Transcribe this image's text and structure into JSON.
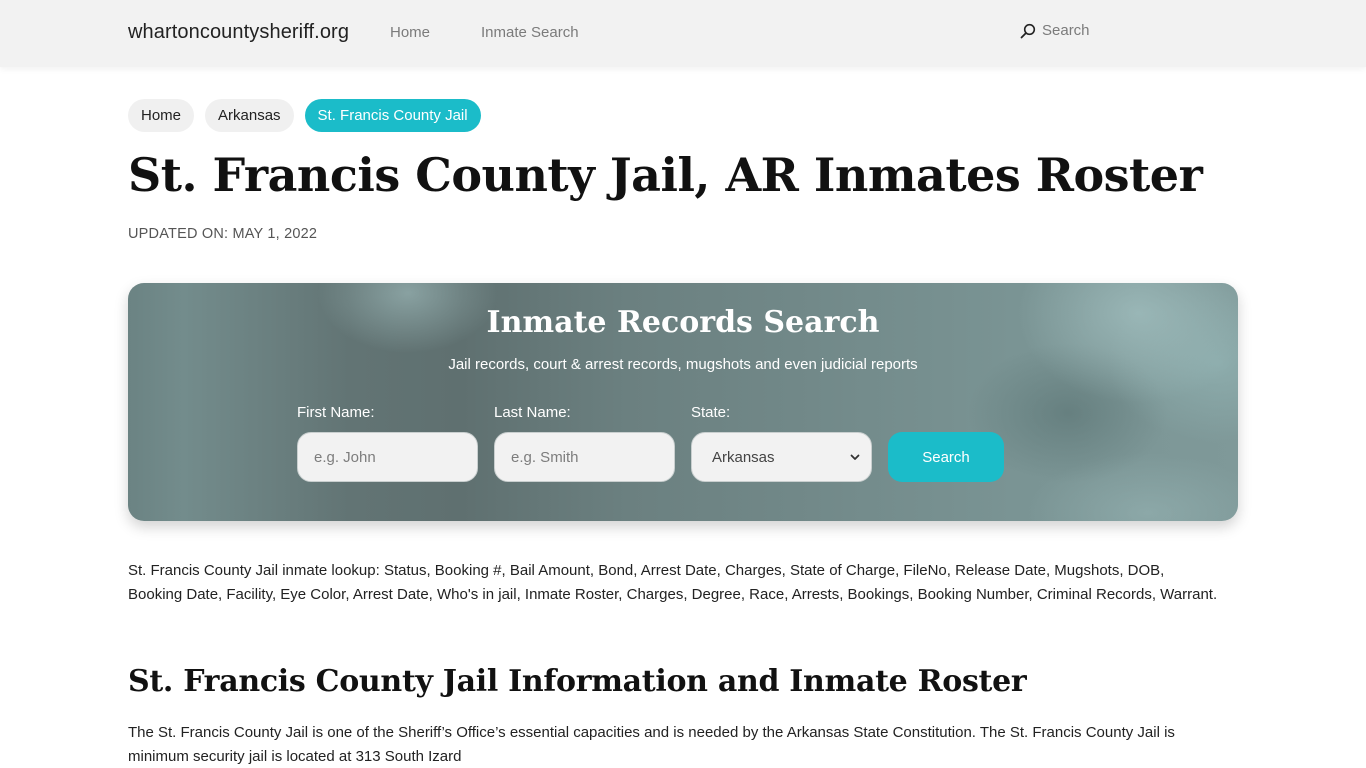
{
  "header": {
    "brand": "whartoncountysheriff.org",
    "nav": [
      {
        "label": "Home"
      },
      {
        "label": "Inmate Search"
      }
    ],
    "search_label": "Search",
    "search_icon": "search-icon"
  },
  "breadcrumb": [
    {
      "label": "Home",
      "active": false
    },
    {
      "label": "Arkansas",
      "active": false
    },
    {
      "label": "St. Francis County Jail",
      "active": true
    }
  ],
  "page": {
    "title": "St. Francis County Jail, AR Inmates Roster",
    "updated": "UPDATED ON: MAY 1, 2022"
  },
  "search_panel": {
    "title": "Inmate Records Search",
    "subtitle": "Jail records, court & arrest records, mugshots and even judicial reports",
    "first_name": {
      "label": "First Name:",
      "placeholder": "e.g. John",
      "value": ""
    },
    "last_name": {
      "label": "Last Name:",
      "placeholder": "e.g. Smith",
      "value": ""
    },
    "state": {
      "label": "State:",
      "selected": "Arkansas"
    },
    "button_label": "Search",
    "accent_color": "#1bbcc9"
  },
  "content": {
    "lookup_text": "St. Francis County Jail inmate lookup: Status, Booking #, Bail Amount, Bond, Arrest Date, Charges, State of Charge, FileNo, Release Date, Mugshots, DOB, Booking Date, Facility, Eye Color, Arrest Date, Who's in jail, Inmate Roster, Charges, Degree, Race, Arrests, Bookings, Booking Number, Criminal Records, Warrant.",
    "section_title": "St. Francis County Jail Information and Inmate Roster",
    "intro_text": "The St. Francis County Jail is one of the Sheriff’s Office’s essential capacities and is needed by the Arkansas State Constitution. The St. Francis County Jail is minimum security jail is located at 313 South Izard"
  }
}
